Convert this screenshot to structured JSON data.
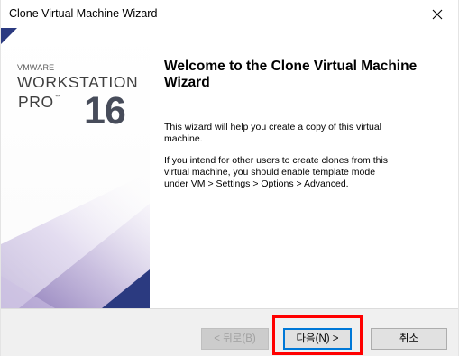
{
  "window": {
    "title": "Clone Virtual Machine Wizard"
  },
  "branding": {
    "vendor": "VMWARE",
    "product": "WORKSTATION",
    "edition": "PRO",
    "trademark": "™",
    "version": "16"
  },
  "content": {
    "heading": "Welcome to the Clone Virtual Machine Wizard",
    "paragraph1": "This wizard will help you create a copy of this virtual machine.",
    "paragraph2": "If you intend for other users to create clones from this virtual machine, you should enable template mode under VM > Settings > Options > Advanced."
  },
  "footer": {
    "back_label": "< 뒤로(B)",
    "next_label": "다음(N) >",
    "cancel_label": "취소"
  },
  "colors": {
    "accent": "#0078d7",
    "highlight": "#ff0000",
    "banner_navy": "#2b3a80",
    "banner_purple": "#b8a7d6"
  },
  "icons": {
    "close": "close-icon"
  }
}
